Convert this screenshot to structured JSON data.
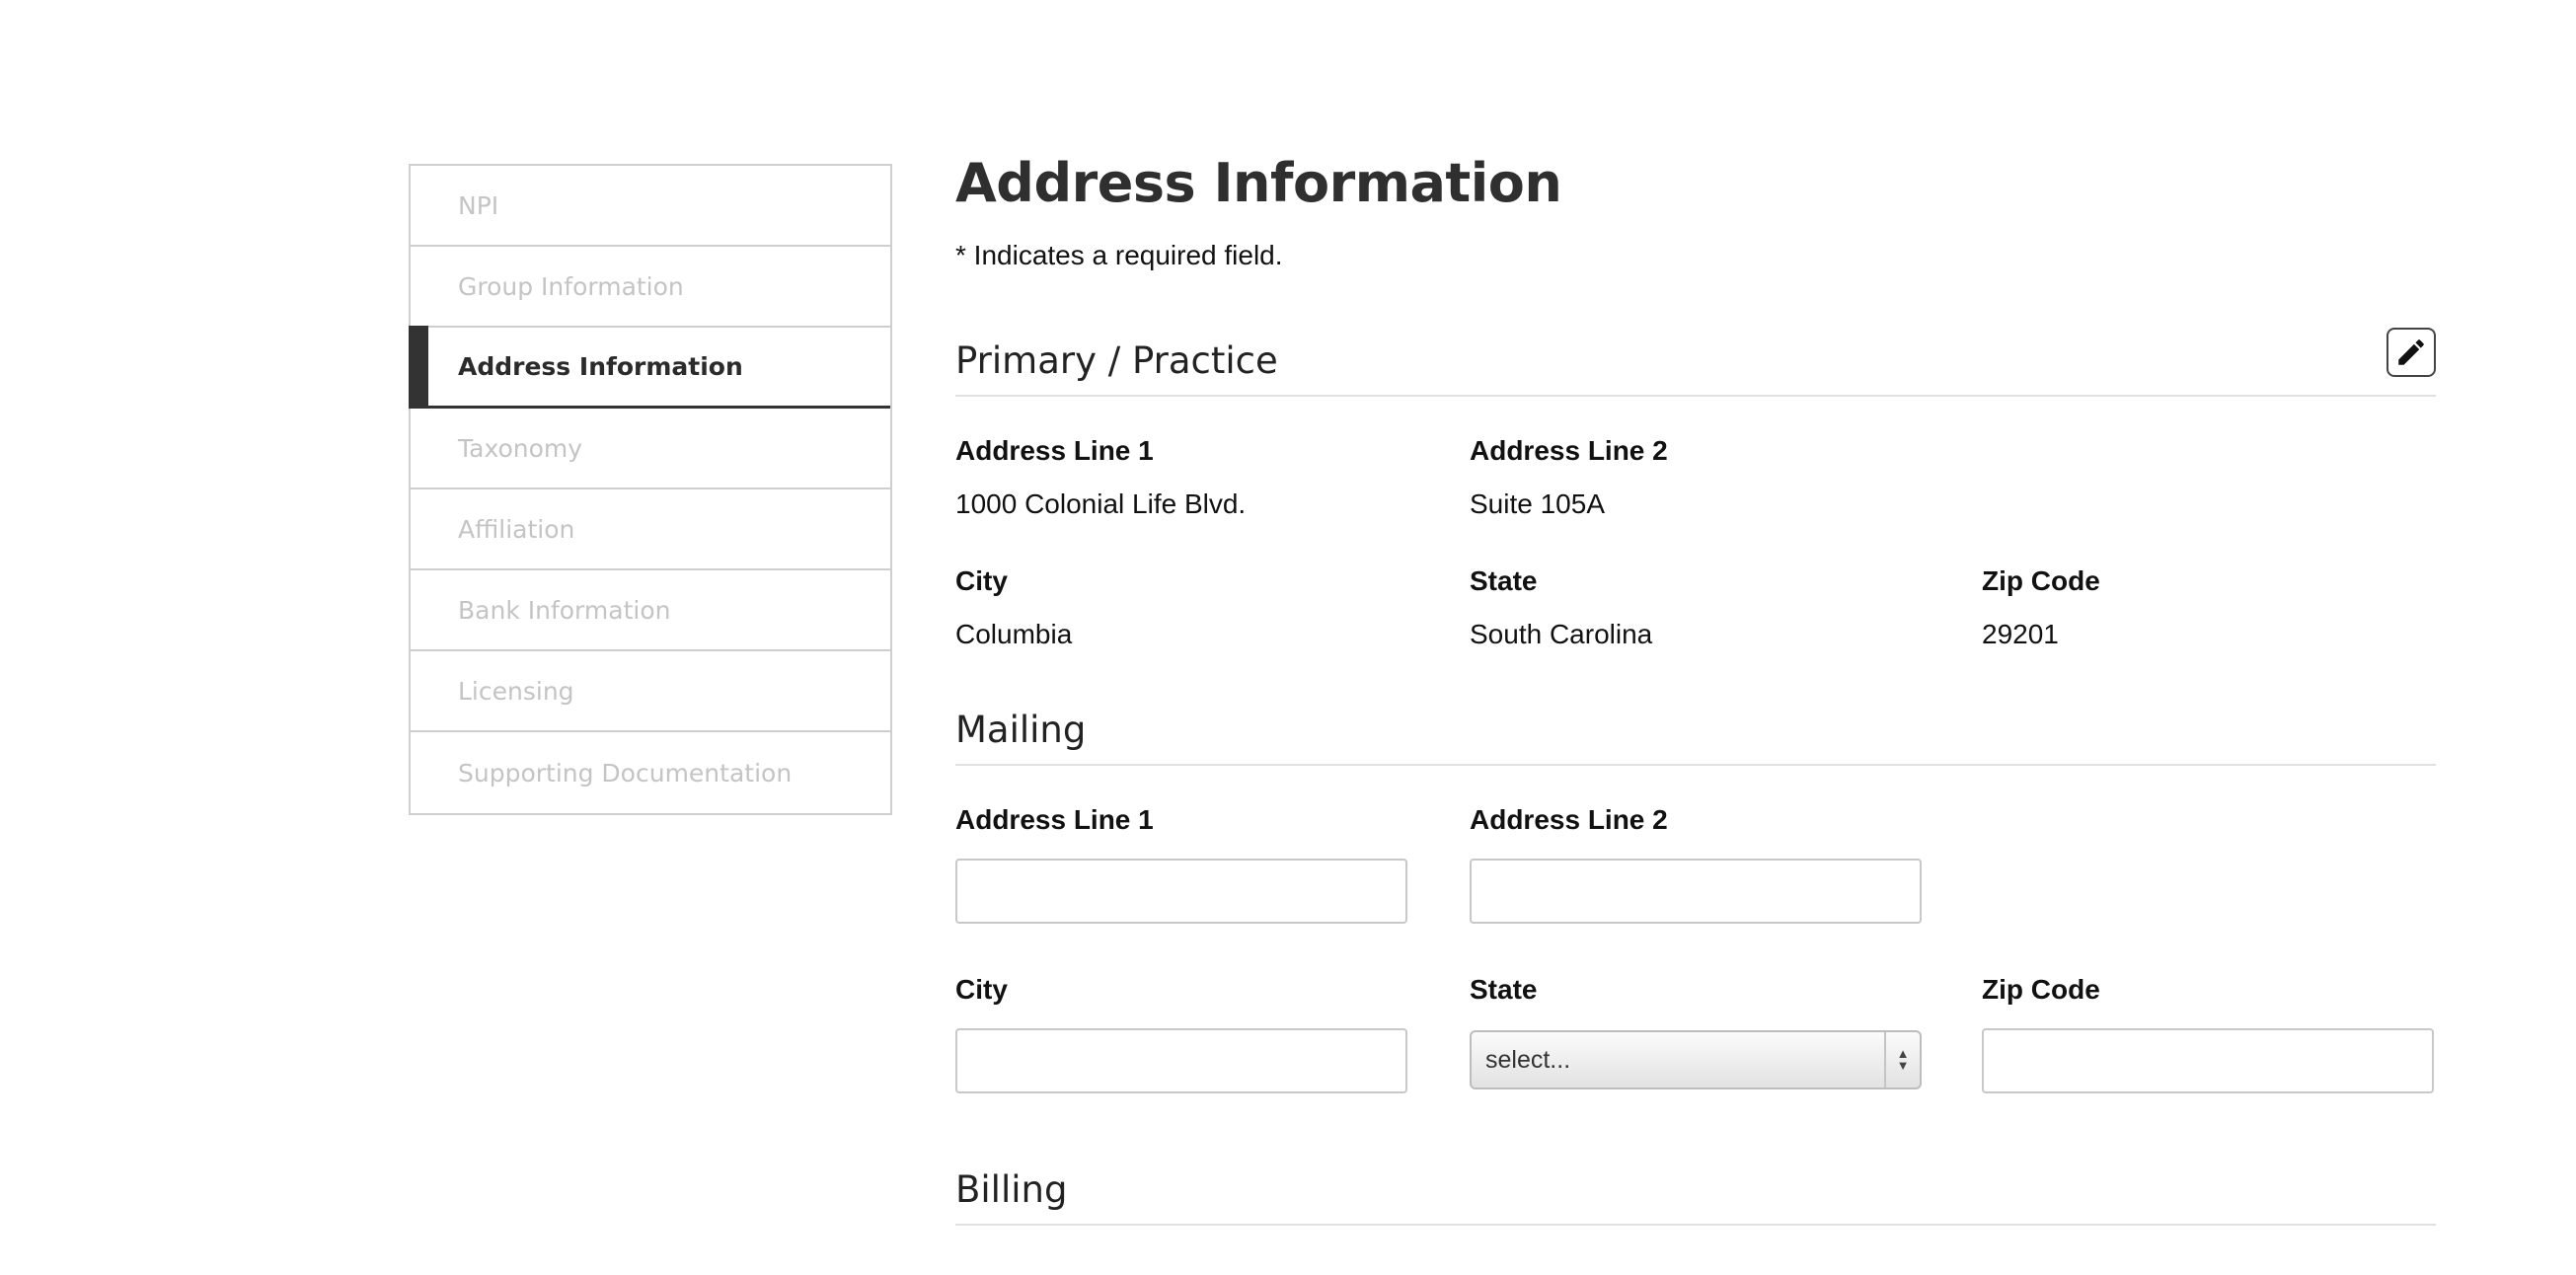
{
  "sidebar": {
    "items": [
      {
        "label": "NPI",
        "active": false
      },
      {
        "label": "Group Information",
        "active": false
      },
      {
        "label": "Address Information",
        "active": true
      },
      {
        "label": "Taxonomy",
        "active": false
      },
      {
        "label": "Affiliation",
        "active": false
      },
      {
        "label": "Bank Information",
        "active": false
      },
      {
        "label": "Licensing",
        "active": false
      },
      {
        "label": "Supporting Documentation",
        "active": false
      }
    ]
  },
  "main": {
    "title": "Address Information",
    "required_note": "* Indicates a required field.",
    "primary": {
      "header": "Primary / Practice",
      "edit_icon": "pencil-icon",
      "address_line1_label": "Address Line 1",
      "address_line1_value": "1000 Colonial Life Blvd.",
      "address_line2_label": "Address Line 2",
      "address_line2_value": "Suite 105A",
      "city_label": "City",
      "city_value": "Columbia",
      "state_label": "State",
      "state_value": "South Carolina",
      "zip_label": "Zip Code",
      "zip_value": "29201"
    },
    "mailing": {
      "header": "Mailing",
      "address_line1_label": "Address Line 1",
      "address_line1_value": "",
      "address_line2_label": "Address Line 2",
      "address_line2_value": "",
      "city_label": "City",
      "city_value": "",
      "state_label": "State",
      "state_selected": "select...",
      "zip_label": "Zip Code",
      "zip_value": ""
    },
    "billing": {
      "header": "Billing"
    }
  }
}
